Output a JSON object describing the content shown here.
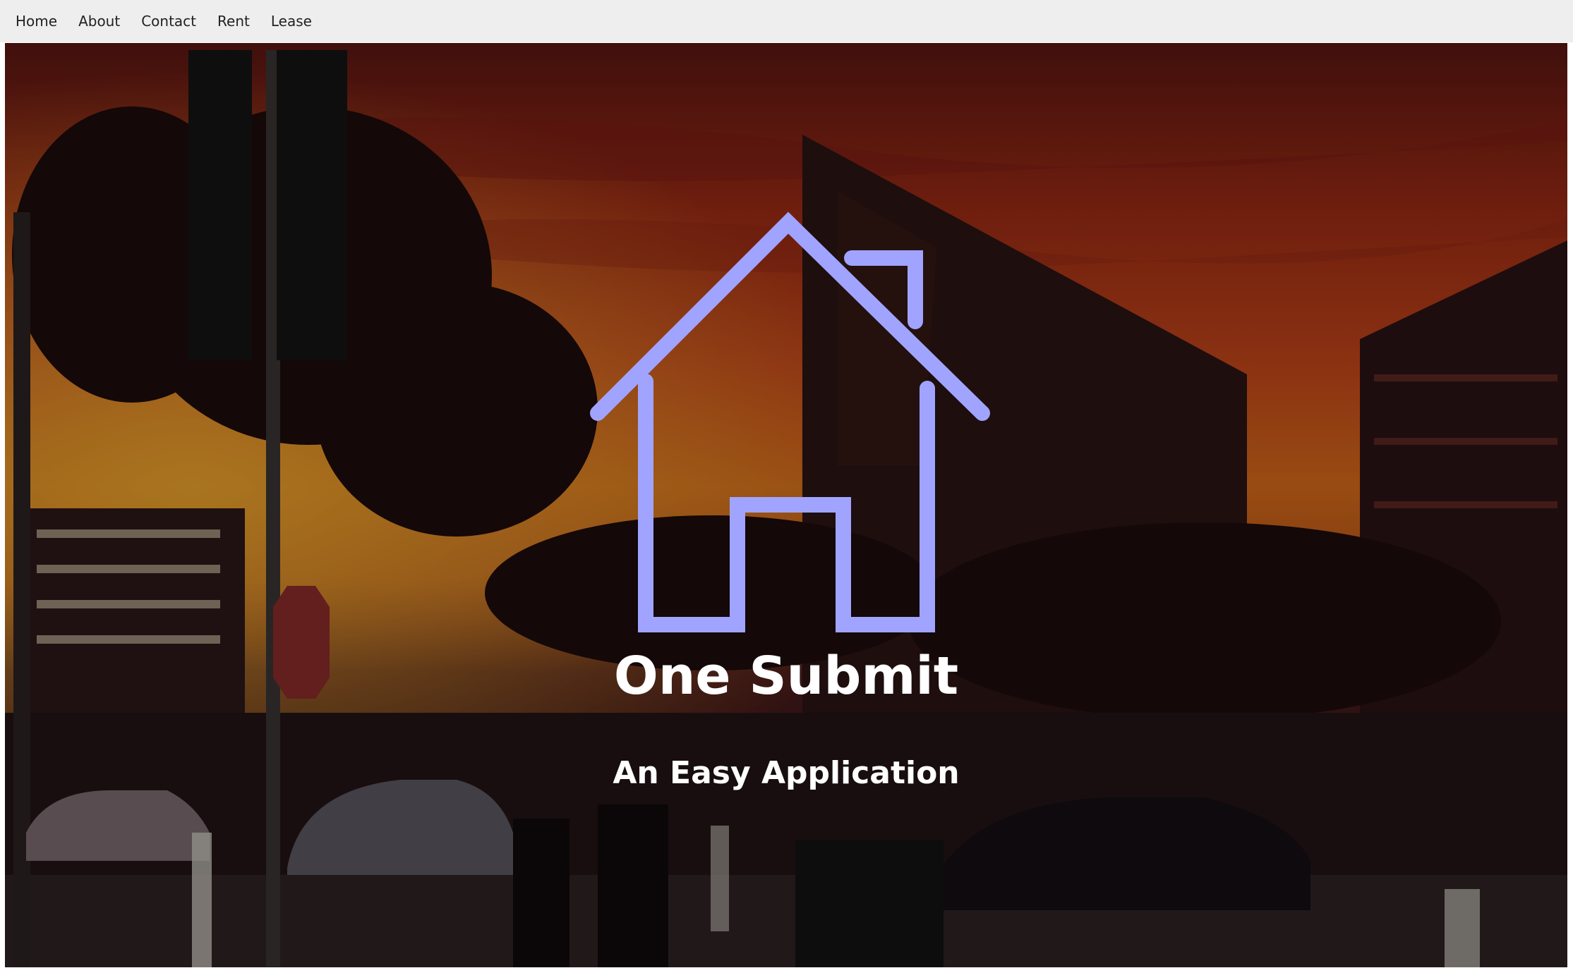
{
  "nav": {
    "items": [
      {
        "label": "Home"
      },
      {
        "label": "About"
      },
      {
        "label": "Contact"
      },
      {
        "label": "Rent"
      },
      {
        "label": "Lease"
      }
    ]
  },
  "hero": {
    "background_image": "sunset-campus-street-photo",
    "logo_icon": "house-icon",
    "logo_color": "#a0a4ff",
    "title": "One Submit",
    "subtitle": "An Easy Application"
  },
  "colors": {
    "navbar_bg": "#eeeeee",
    "nav_text": "#222222",
    "hero_text": "#ffffff"
  }
}
